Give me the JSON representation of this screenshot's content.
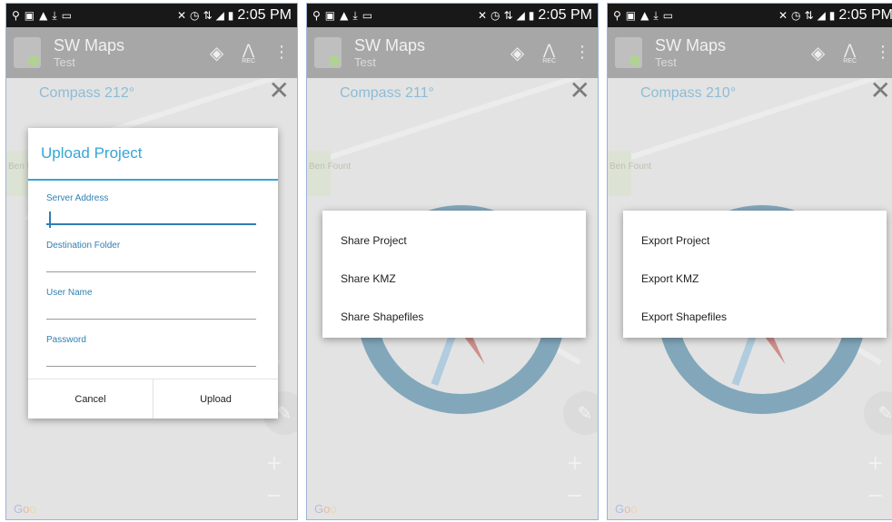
{
  "status_bar": {
    "time": "2:05 PM",
    "left_icons": [
      "location-icon",
      "image-icon",
      "drive-icon",
      "download-icon",
      "keyboard-icon"
    ],
    "right_icons": [
      "mute-icon",
      "alarm-icon",
      "network-4g-icon",
      "signal-icon",
      "battery-icon"
    ]
  },
  "toolbar": {
    "title": "SW Maps",
    "subtitle": "Test",
    "rec_label": "REC"
  },
  "map": {
    "park_label": "Ben Fount",
    "google": "Goo"
  },
  "screens": [
    {
      "compass": "Compass 212°"
    },
    {
      "compass": "Compass 211°"
    },
    {
      "compass": "Compass 210°"
    }
  ],
  "upload_dialog": {
    "title": "Upload Project",
    "fields": [
      {
        "label": "Server Address",
        "value": ""
      },
      {
        "label": "Destination Folder",
        "value": ""
      },
      {
        "label": "User Name",
        "value": ""
      },
      {
        "label": "Password",
        "value": ""
      }
    ],
    "cancel": "Cancel",
    "upload": "Upload"
  },
  "share_menu": {
    "items": [
      "Share Project",
      "Share KMZ",
      "Share Shapefiles"
    ]
  },
  "export_menu": {
    "items": [
      "Export Project",
      "Export KMZ",
      "Export Shapefiles"
    ]
  },
  "colors": {
    "accent": "#35a6d6",
    "compass_ring": "#1d5f84",
    "toolbar": "#5f5f5f",
    "statusbar": "#181818",
    "needle": "#a8322c"
  }
}
